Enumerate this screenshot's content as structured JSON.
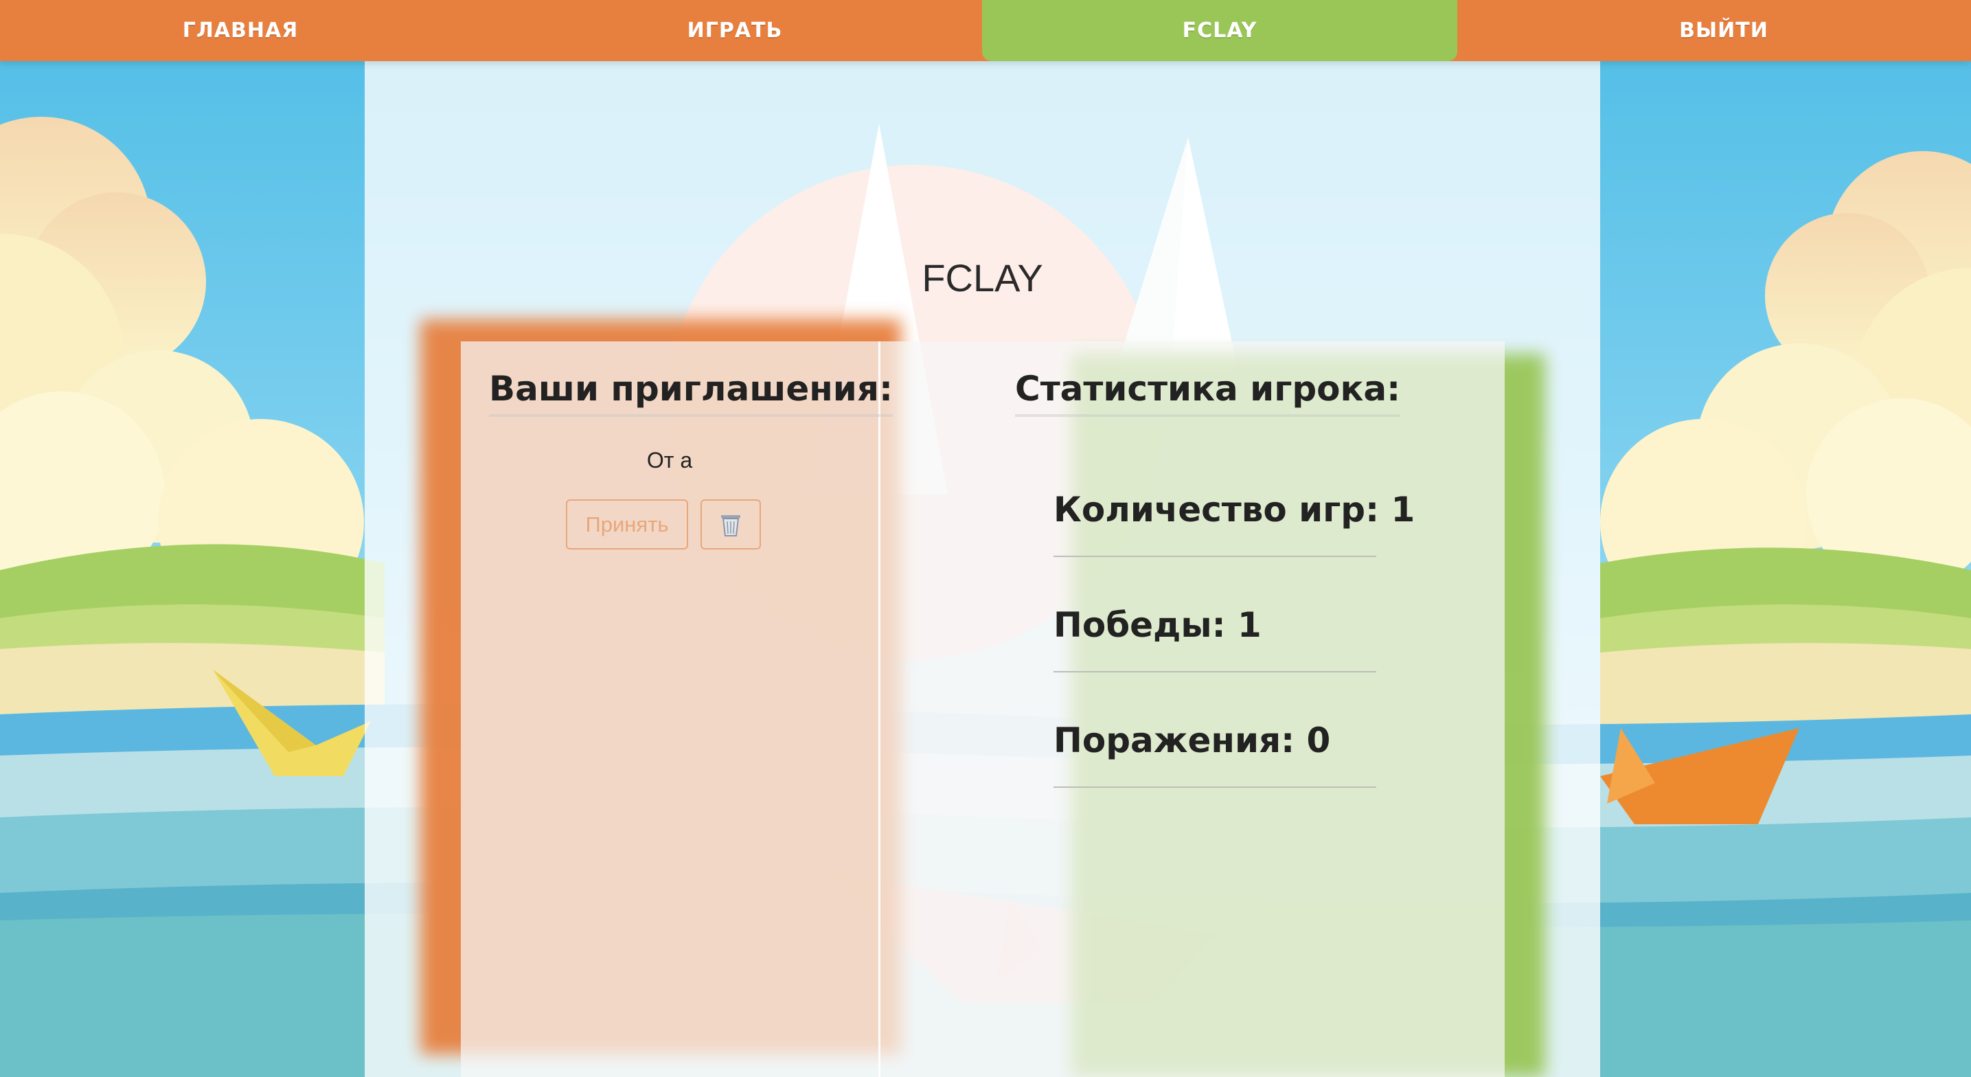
{
  "nav": {
    "items": [
      {
        "label": "ГЛАВНАЯ",
        "active": false
      },
      {
        "label": "ИГРАТЬ",
        "active": false
      },
      {
        "label": "FCLAY",
        "active": true
      },
      {
        "label": "ВЫЙТИ",
        "active": false
      }
    ]
  },
  "page": {
    "title": "FCLAY"
  },
  "invitations": {
    "title": "Ваши приглашения:",
    "items": [
      {
        "from_text": "От а",
        "accept_label": "Принять",
        "delete_icon": "trash-icon"
      }
    ]
  },
  "stats": {
    "title": "Статистика игрока:",
    "rows": [
      {
        "label": "Количество игр: 1"
      },
      {
        "label": "Победы: 1"
      },
      {
        "label": "Поражения: 0"
      }
    ]
  },
  "colors": {
    "nav_bg": "#e7803f",
    "nav_active": "#9ac658",
    "accent_orange": "#e7803f",
    "accent_green": "#9ac658",
    "sky": "#5ec5ec",
    "sea": "#6cc0c7"
  }
}
